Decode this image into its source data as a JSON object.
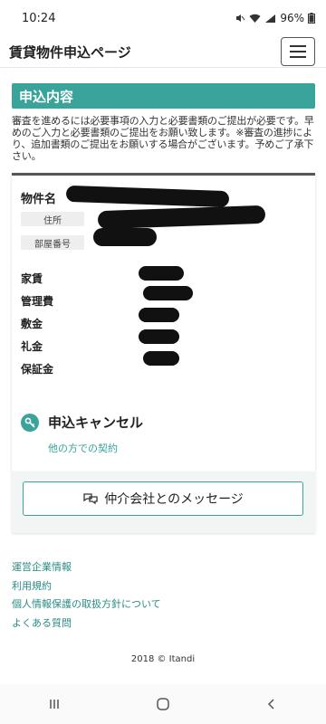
{
  "status": {
    "time": "10:24",
    "battery": "96%"
  },
  "app": {
    "title": "賃貸物件申込ページ"
  },
  "section": {
    "title": "申込内容"
  },
  "notice": "審査を進めるには必要事項の入力と必要書類のご提出が必要です。早めのご入力と必要書類のご提出をお願い致します。※審査の進捗により、追加書類のご提出をお願いする場合がございます。予めご了承下さい。",
  "property": {
    "name_label": "物件名",
    "address_tag": "住所",
    "room_tag": "部屋番号",
    "fees": [
      {
        "label": "家賃"
      },
      {
        "label": "管理費"
      },
      {
        "label": "敷金"
      },
      {
        "label": "礼金"
      },
      {
        "label": "保証金"
      }
    ]
  },
  "cancel": {
    "label": "申込キャンセル",
    "sub": "他の方での契約"
  },
  "message_button": {
    "label": "仲介会社とのメッセージ"
  },
  "footer": {
    "links": [
      "運営企業情報",
      "利用規約",
      "個人情報保護の取扱方針について",
      "よくある質問"
    ],
    "copyright": "2018 © Itandi"
  },
  "colors": {
    "accent": "#3aa39a"
  }
}
